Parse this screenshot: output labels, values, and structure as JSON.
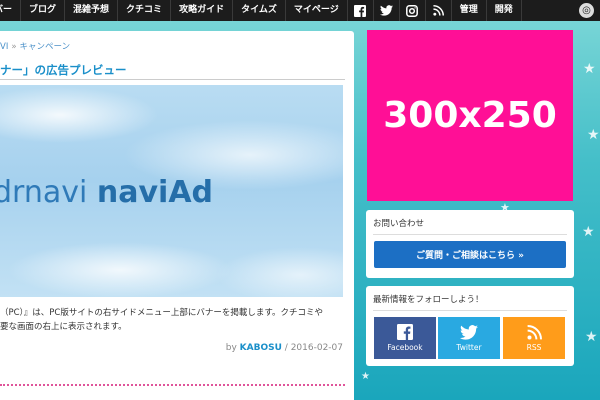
{
  "nav": {
    "items": [
      "バー",
      "ブログ",
      "混雑予想",
      "クチコミ",
      "攻略ガイド",
      "タイムズ",
      "マイページ"
    ],
    "admin": "管理",
    "dev": "開発",
    "icons": [
      "facebook-icon",
      "twitter-icon",
      "instagram-icon",
      "rss-icon"
    ]
  },
  "article": {
    "breadcrumb_prefix": "VI",
    "breadcrumb_sep": "»",
    "breadcrumb_link": "キャンペーン",
    "title": "ナー」の広告プレビュー",
    "hero_text_light": "drnavi ",
    "hero_text_bold": "naviAd",
    "body_line1": "（PC）』は、PC版サイトの右サイドメニュー上部にバナーを掲載します。クチコミや",
    "body_line2": "要な画面の右上に表示されます。",
    "by": "by",
    "author": "KABOSU",
    "date": "/ 2016-02-07"
  },
  "ad": {
    "label": "300x250"
  },
  "contact": {
    "title": "お問い合わせ",
    "button": "ご質問・ご相談はこちら »"
  },
  "follow": {
    "title": "最新情報をフォローしよう！",
    "facebook": "Facebook",
    "twitter": "Twitter",
    "rss": "RSS"
  },
  "colors": {
    "nav_bg": "#1c1c1c",
    "link": "#1a8fc9",
    "ad_bg": "#ff0f96",
    "contact_btn": "#1c6fc4",
    "facebook": "#3b5998",
    "twitter": "#29a9e1",
    "rss": "#ff9c1a"
  }
}
